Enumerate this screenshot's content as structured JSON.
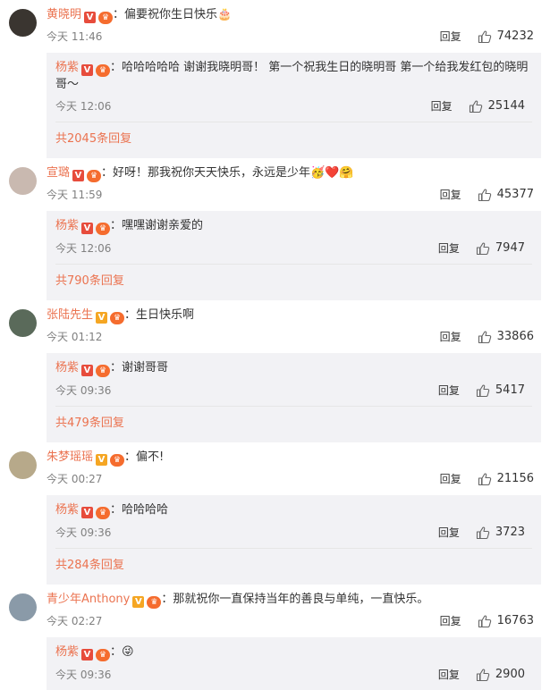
{
  "comments": [
    {
      "user": "黄晓明",
      "badge": "red",
      "text": "：偏要祝你生日快乐🎂",
      "time": "今天 11:46",
      "reply": "回复",
      "likes": "74232",
      "avatar_color": "#3a3530",
      "sub": {
        "user": "杨紫",
        "text": "：哈哈哈哈哈 谢谢我晓明哥！ 第一个祝我生日的晓明哥 第一个给我发红包的晓明哥～",
        "time": "今天 12:06",
        "reply": "回复",
        "likes": "25144"
      },
      "more": "共2045条回复"
    },
    {
      "user": "宣璐",
      "badge": "red",
      "text": "：好呀！那我祝你天天快乐，永远是少年🥳❤️🤗",
      "time": "今天 11:59",
      "reply": "回复",
      "likes": "45377",
      "avatar_color": "#c9b9b0",
      "sub": {
        "user": "杨紫",
        "text": "：嘿嘿谢谢亲爱的",
        "time": "今天 12:06",
        "reply": "回复",
        "likes": "7947"
      },
      "more": "共790条回复"
    },
    {
      "user": "张陆先生",
      "badge": "gold",
      "text": "：生日快乐啊",
      "time": "今天 01:12",
      "reply": "回复",
      "likes": "33866",
      "avatar_color": "#5a6a5a",
      "sub": {
        "user": "杨紫",
        "text": "：谢谢哥哥",
        "time": "今天 09:36",
        "reply": "回复",
        "likes": "5417"
      },
      "more": "共479条回复"
    },
    {
      "user": "朱梦瑶瑶",
      "badge": "gold",
      "text": "：偏不!",
      "time": "今天 00:27",
      "reply": "回复",
      "likes": "21156",
      "avatar_color": "#b7a98a",
      "sub": {
        "user": "杨紫",
        "text": "：哈哈哈哈",
        "time": "今天 09:36",
        "reply": "回复",
        "likes": "3723"
      },
      "more": "共284条回复"
    },
    {
      "user": "青少年Anthony",
      "badge": "gold",
      "text": "：那就祝你一直保持当年的善良与单纯，一直快乐。",
      "time": "今天 02:27",
      "reply": "回复",
      "likes": "16763",
      "avatar_color": "#8a9aa8",
      "sub": {
        "user": "杨紫",
        "text": "：😜",
        "time": "今天 09:36",
        "reply": "回复",
        "likes": "2900"
      },
      "more": ""
    }
  ],
  "badge_glyph": "V",
  "vip_glyph": "♛"
}
